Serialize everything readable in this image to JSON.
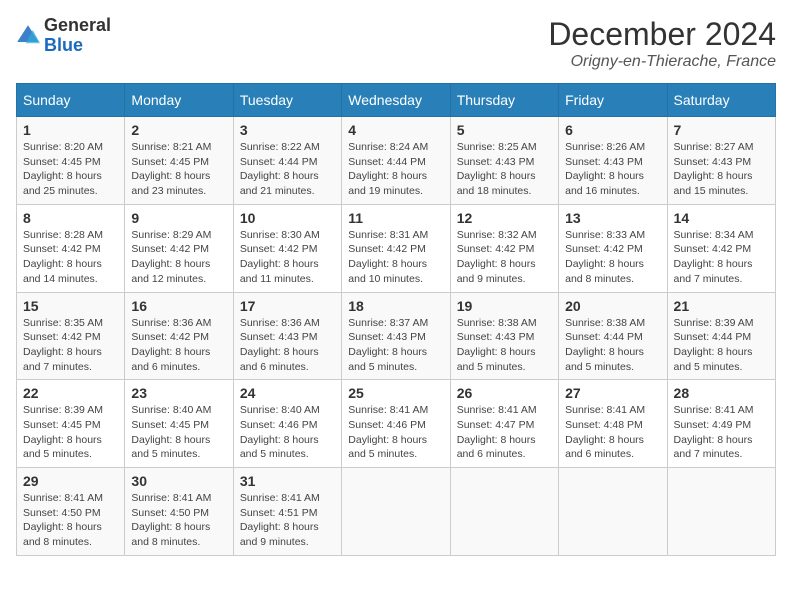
{
  "header": {
    "logo_general": "General",
    "logo_blue": "Blue",
    "month": "December 2024",
    "location": "Origny-en-Thierache, France"
  },
  "weekdays": [
    "Sunday",
    "Monday",
    "Tuesday",
    "Wednesday",
    "Thursday",
    "Friday",
    "Saturday"
  ],
  "weeks": [
    [
      {
        "day": "1",
        "sunrise": "8:20 AM",
        "sunset": "4:45 PM",
        "daylight": "8 hours and 25 minutes."
      },
      {
        "day": "2",
        "sunrise": "8:21 AM",
        "sunset": "4:45 PM",
        "daylight": "8 hours and 23 minutes."
      },
      {
        "day": "3",
        "sunrise": "8:22 AM",
        "sunset": "4:44 PM",
        "daylight": "8 hours and 21 minutes."
      },
      {
        "day": "4",
        "sunrise": "8:24 AM",
        "sunset": "4:44 PM",
        "daylight": "8 hours and 19 minutes."
      },
      {
        "day": "5",
        "sunrise": "8:25 AM",
        "sunset": "4:43 PM",
        "daylight": "8 hours and 18 minutes."
      },
      {
        "day": "6",
        "sunrise": "8:26 AM",
        "sunset": "4:43 PM",
        "daylight": "8 hours and 16 minutes."
      },
      {
        "day": "7",
        "sunrise": "8:27 AM",
        "sunset": "4:43 PM",
        "daylight": "8 hours and 15 minutes."
      }
    ],
    [
      {
        "day": "8",
        "sunrise": "8:28 AM",
        "sunset": "4:42 PM",
        "daylight": "8 hours and 14 minutes."
      },
      {
        "day": "9",
        "sunrise": "8:29 AM",
        "sunset": "4:42 PM",
        "daylight": "8 hours and 12 minutes."
      },
      {
        "day": "10",
        "sunrise": "8:30 AM",
        "sunset": "4:42 PM",
        "daylight": "8 hours and 11 minutes."
      },
      {
        "day": "11",
        "sunrise": "8:31 AM",
        "sunset": "4:42 PM",
        "daylight": "8 hours and 10 minutes."
      },
      {
        "day": "12",
        "sunrise": "8:32 AM",
        "sunset": "4:42 PM",
        "daylight": "8 hours and 9 minutes."
      },
      {
        "day": "13",
        "sunrise": "8:33 AM",
        "sunset": "4:42 PM",
        "daylight": "8 hours and 8 minutes."
      },
      {
        "day": "14",
        "sunrise": "8:34 AM",
        "sunset": "4:42 PM",
        "daylight": "8 hours and 7 minutes."
      }
    ],
    [
      {
        "day": "15",
        "sunrise": "8:35 AM",
        "sunset": "4:42 PM",
        "daylight": "8 hours and 7 minutes."
      },
      {
        "day": "16",
        "sunrise": "8:36 AM",
        "sunset": "4:42 PM",
        "daylight": "8 hours and 6 minutes."
      },
      {
        "day": "17",
        "sunrise": "8:36 AM",
        "sunset": "4:43 PM",
        "daylight": "8 hours and 6 minutes."
      },
      {
        "day": "18",
        "sunrise": "8:37 AM",
        "sunset": "4:43 PM",
        "daylight": "8 hours and 5 minutes."
      },
      {
        "day": "19",
        "sunrise": "8:38 AM",
        "sunset": "4:43 PM",
        "daylight": "8 hours and 5 minutes."
      },
      {
        "day": "20",
        "sunrise": "8:38 AM",
        "sunset": "4:44 PM",
        "daylight": "8 hours and 5 minutes."
      },
      {
        "day": "21",
        "sunrise": "8:39 AM",
        "sunset": "4:44 PM",
        "daylight": "8 hours and 5 minutes."
      }
    ],
    [
      {
        "day": "22",
        "sunrise": "8:39 AM",
        "sunset": "4:45 PM",
        "daylight": "8 hours and 5 minutes."
      },
      {
        "day": "23",
        "sunrise": "8:40 AM",
        "sunset": "4:45 PM",
        "daylight": "8 hours and 5 minutes."
      },
      {
        "day": "24",
        "sunrise": "8:40 AM",
        "sunset": "4:46 PM",
        "daylight": "8 hours and 5 minutes."
      },
      {
        "day": "25",
        "sunrise": "8:41 AM",
        "sunset": "4:46 PM",
        "daylight": "8 hours and 5 minutes."
      },
      {
        "day": "26",
        "sunrise": "8:41 AM",
        "sunset": "4:47 PM",
        "daylight": "8 hours and 6 minutes."
      },
      {
        "day": "27",
        "sunrise": "8:41 AM",
        "sunset": "4:48 PM",
        "daylight": "8 hours and 6 minutes."
      },
      {
        "day": "28",
        "sunrise": "8:41 AM",
        "sunset": "4:49 PM",
        "daylight": "8 hours and 7 minutes."
      }
    ],
    [
      {
        "day": "29",
        "sunrise": "8:41 AM",
        "sunset": "4:50 PM",
        "daylight": "8 hours and 8 minutes."
      },
      {
        "day": "30",
        "sunrise": "8:41 AM",
        "sunset": "4:50 PM",
        "daylight": "8 hours and 8 minutes."
      },
      {
        "day": "31",
        "sunrise": "8:41 AM",
        "sunset": "4:51 PM",
        "daylight": "8 hours and 9 minutes."
      },
      null,
      null,
      null,
      null
    ]
  ]
}
